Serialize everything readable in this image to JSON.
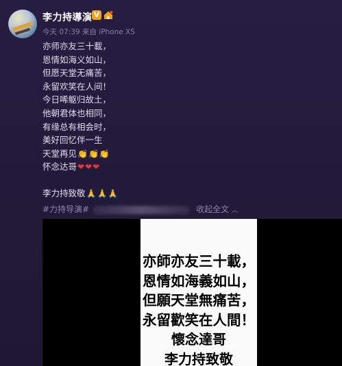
{
  "header": {
    "username": "李力持導演",
    "verified_badge": "V",
    "meta": "今天 07:39 来自 iPhone XS"
  },
  "post": {
    "lines": [
      "亦师亦友三十載，",
      "恩情如海义如山，",
      "但愿天堂无痛苦，",
      "永留欢笑在人间！",
      "今日唏躯归故土，",
      "他朝君体也相同，",
      "有缘总有相会时，",
      "美好回忆伴一生",
      "天堂再见",
      "怀念达哥"
    ],
    "emojis": {
      "clap": "👏",
      "heart": "❤",
      "pray": "🙏"
    },
    "signature": "李力持致敬",
    "hashtag": "#力持导演#",
    "collapse_label": "收起全文"
  },
  "image": {
    "lines": [
      "亦師亦友三十載，",
      "恩情如海義如山，",
      "但願天堂無痛苦，",
      "永留歡笑在人間！",
      "懷念達哥",
      "李力持致敬"
    ]
  },
  "colors": {
    "background": "#231a3c",
    "text": "#e0dbec",
    "muted": "#8a82a3",
    "link": "#8f84b0",
    "vip_badge": "#f2a118"
  }
}
